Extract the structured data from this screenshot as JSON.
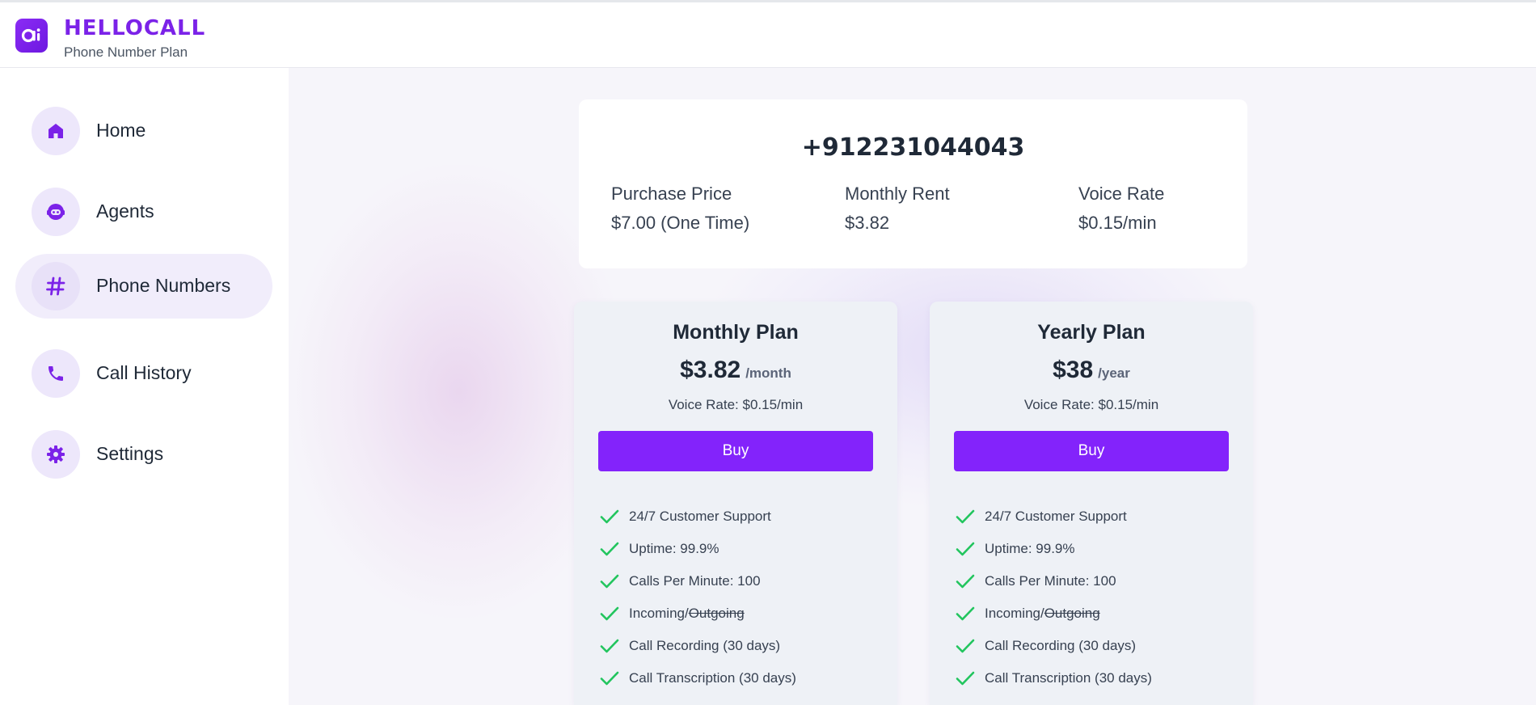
{
  "app": {
    "brand_name": "HELLOCALL",
    "page_subtitle": "Phone Number Plan",
    "logo_text": "ai"
  },
  "colors": {
    "accent": "#8323fb",
    "brand": "#7b22e8",
    "check": "#22c55e",
    "nav_icon_bg": "#ede7fb"
  },
  "sidebar": {
    "items": [
      {
        "label": "Home",
        "icon": "home-icon",
        "active": false
      },
      {
        "label": "Agents",
        "icon": "agent-icon",
        "active": false
      },
      {
        "label": "Phone Numbers",
        "icon": "hash-icon",
        "active": true
      },
      {
        "label": "Call History",
        "icon": "phone-icon",
        "active": false
      },
      {
        "label": "Settings",
        "icon": "gear-icon",
        "active": false
      }
    ]
  },
  "number_card": {
    "phone_number": "+912231044043",
    "stats": [
      {
        "label": "Purchase Price",
        "value": "$7.00 (One Time)"
      },
      {
        "label": "Monthly Rent",
        "value": "$3.82"
      },
      {
        "label": "Voice Rate",
        "value": "$0.15/min"
      }
    ]
  },
  "plans": [
    {
      "title": "Monthly Plan",
      "price": "$3.82",
      "period": "/month",
      "voice_rate": "Voice Rate: $0.15/min",
      "button_label": "Buy",
      "features": [
        {
          "text": "24/7 Customer Support"
        },
        {
          "text": "Uptime: 99.9%"
        },
        {
          "text": "Calls Per Minute: 100"
        },
        {
          "text": "Incoming/",
          "struck": "Outgoing"
        },
        {
          "text": "Call Recording (30 days)"
        },
        {
          "text": "Call Transcription (30 days)"
        }
      ]
    },
    {
      "title": "Yearly Plan",
      "price": "$38",
      "period": "/year",
      "voice_rate": "Voice Rate: $0.15/min",
      "button_label": "Buy",
      "features": [
        {
          "text": "24/7 Customer Support"
        },
        {
          "text": "Uptime: 99.9%"
        },
        {
          "text": "Calls Per Minute: 100"
        },
        {
          "text": "Incoming/",
          "struck": "Outgoing"
        },
        {
          "text": "Call Recording (30 days)"
        },
        {
          "text": "Call Transcription (30 days)"
        }
      ]
    }
  ]
}
